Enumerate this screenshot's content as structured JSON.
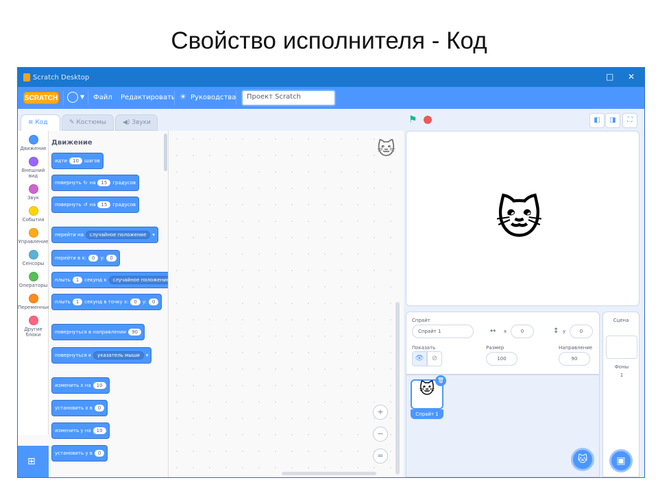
{
  "slide_title": "Свойство исполнителя - Код",
  "window": {
    "title": "Scratch Desktop",
    "minimize": "_",
    "maximize": "□",
    "close": "✕"
  },
  "menu": {
    "logo": "SCRATCH",
    "file": "Файл",
    "edit": "Редактировать",
    "tutorials": "Руководства",
    "project_title": "Проект Scratch"
  },
  "tabs": {
    "code": "Код",
    "costumes": "Костюмы",
    "sounds": "Звуки"
  },
  "categories": [
    {
      "label": "Движение",
      "color": "#4c97ff"
    },
    {
      "label": "Внешний вид",
      "color": "#9966ff"
    },
    {
      "label": "Звук",
      "color": "#cf63cf"
    },
    {
      "label": "События",
      "color": "#ffd500"
    },
    {
      "label": "Управление",
      "color": "#ffab19"
    },
    {
      "label": "Сенсоры",
      "color": "#5cb1d6"
    },
    {
      "label": "Операторы",
      "color": "#59c059"
    },
    {
      "label": "Переменные",
      "color": "#ff8c1a"
    },
    {
      "label": "Другие блоки",
      "color": "#ff6680"
    }
  ],
  "palette": {
    "title": "Движение",
    "move": {
      "a": "идти",
      "v": "10",
      "b": "шагов"
    },
    "turn_right": {
      "a": "повернуть",
      "icon": "↻",
      "b": "на",
      "v": "15",
      "c": "градусов"
    },
    "turn_left": {
      "a": "повернуть",
      "icon": "↺",
      "b": "на",
      "v": "15",
      "c": "градусов"
    },
    "goto": {
      "a": "перейти на",
      "dd": "случайное положение"
    },
    "goto_xy": {
      "a": "перейти в x:",
      "x": "0",
      "b": "y:",
      "y": "0"
    },
    "glide": {
      "a": "плыть",
      "v": "1",
      "b": "секунд к",
      "dd": "случайное положение"
    },
    "glide_xy": {
      "a": "плыть",
      "v": "1",
      "b": "секунд в точку x:",
      "x": "0",
      "c": "y:",
      "y": "0"
    },
    "point_dir": {
      "a": "повернуться в направлении",
      "v": "90"
    },
    "point_to": {
      "a": "повернуться к",
      "dd": "указатель мыши"
    },
    "change_x": {
      "a": "изменить x на",
      "v": "10"
    },
    "set_x": {
      "a": "установить x в",
      "v": "0"
    },
    "change_y": {
      "a": "изменить y на",
      "v": "10"
    },
    "set_y": {
      "a": "установить y в",
      "v": "0"
    }
  },
  "zoom": {
    "in": "+",
    "out": "−",
    "reset": "="
  },
  "sprite_info": {
    "sprite_label": "Спрайт",
    "sprite_name": "Спрайт 1",
    "x_label": "x",
    "x_value": "0",
    "y_label": "y",
    "y_value": "0",
    "show_label": "Показать",
    "size_label": "Размер",
    "size_value": "100",
    "direction_label": "Направление",
    "direction_value": "90"
  },
  "sprite_list": {
    "thumb_label": "Спрайт 1"
  },
  "stage_panel": {
    "title": "Сцена",
    "backdrops_label": "Фоны",
    "backdrops_count": "1"
  }
}
